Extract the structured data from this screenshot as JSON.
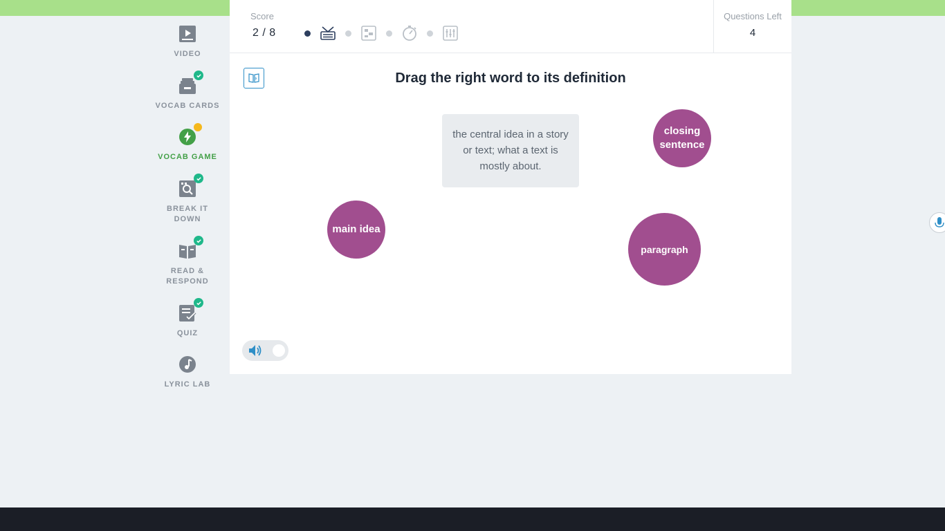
{
  "sidebar": {
    "items": [
      {
        "label": "VIDEO",
        "icon": "video-icon",
        "completed": false
      },
      {
        "label": "VOCAB CARDS",
        "icon": "vocab-cards-icon",
        "completed": true
      },
      {
        "label": "VOCAB GAME",
        "icon": "lightning-icon",
        "active": true,
        "status": "in-progress"
      },
      {
        "label": "BREAK IT DOWN",
        "icon": "break-it-down-icon",
        "completed": true
      },
      {
        "label": "READ & RESPOND",
        "icon": "book-icon",
        "completed": true
      },
      {
        "label": "QUIZ",
        "icon": "quiz-icon",
        "completed": true
      },
      {
        "label": "LYRIC LAB",
        "icon": "music-note-icon",
        "completed": false
      }
    ]
  },
  "header": {
    "score_label": "Score",
    "score_value": "2 / 8",
    "questions_left_label": "Questions Left",
    "questions_left_value": "4",
    "progress_icons": [
      "speech-bubble-icon",
      "puzzle-icon",
      "stopwatch-icon",
      "equalizer-icon"
    ]
  },
  "game": {
    "instruction": "Drag the right word to its definition",
    "definition": "the central idea in a story or text; what a text is mostly about.",
    "words": [
      "closing sentence",
      "main idea",
      "paragraph"
    ]
  },
  "controls": {
    "sound_on": true
  },
  "colors": {
    "bubble": "#a14e8f",
    "active_nav": "#43a047",
    "check_badge": "#1fb88a",
    "progress_badge": "#f5b81c",
    "top_strip": "#a8e08a"
  }
}
